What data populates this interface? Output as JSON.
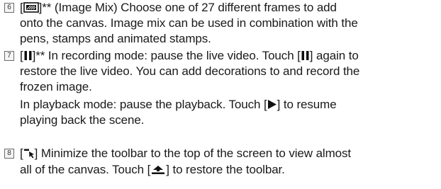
{
  "items": [
    {
      "number": "6",
      "icon": "image-mix-icon",
      "lines": [
        {
          "before": "[",
          "after": "]** (Image Mix) Choose one of 27 different frames to add"
        },
        {
          "text": "onto the canvas. Image mix can be used in combination with the"
        },
        {
          "text": "pens, stamps and animated stamps."
        }
      ]
    },
    {
      "number": "7",
      "icon": "pause-icon",
      "lines": [
        {
          "before": "[",
          "after": "]** In recording mode: pause the live video. Touch [",
          "after2": "] again to"
        },
        {
          "text": "restore the live video. You can add decorations to and record the"
        },
        {
          "text": "frozen image."
        },
        {
          "before": "In playback mode: pause the playback. Touch [",
          "after": "] to resume"
        },
        {
          "text": "playing back the scene."
        }
      ],
      "icon_line3": "play-icon"
    },
    {
      "number": "8",
      "icon": "minimize-toolbar-icon",
      "lines": [
        {
          "before": "[",
          "after": "] Minimize the toolbar to the top of the screen to view almost"
        },
        {
          "before": "all of the canvas. Touch [",
          "after": "] to restore the toolbar."
        }
      ],
      "icon_line1": "restore-toolbar-icon"
    }
  ]
}
